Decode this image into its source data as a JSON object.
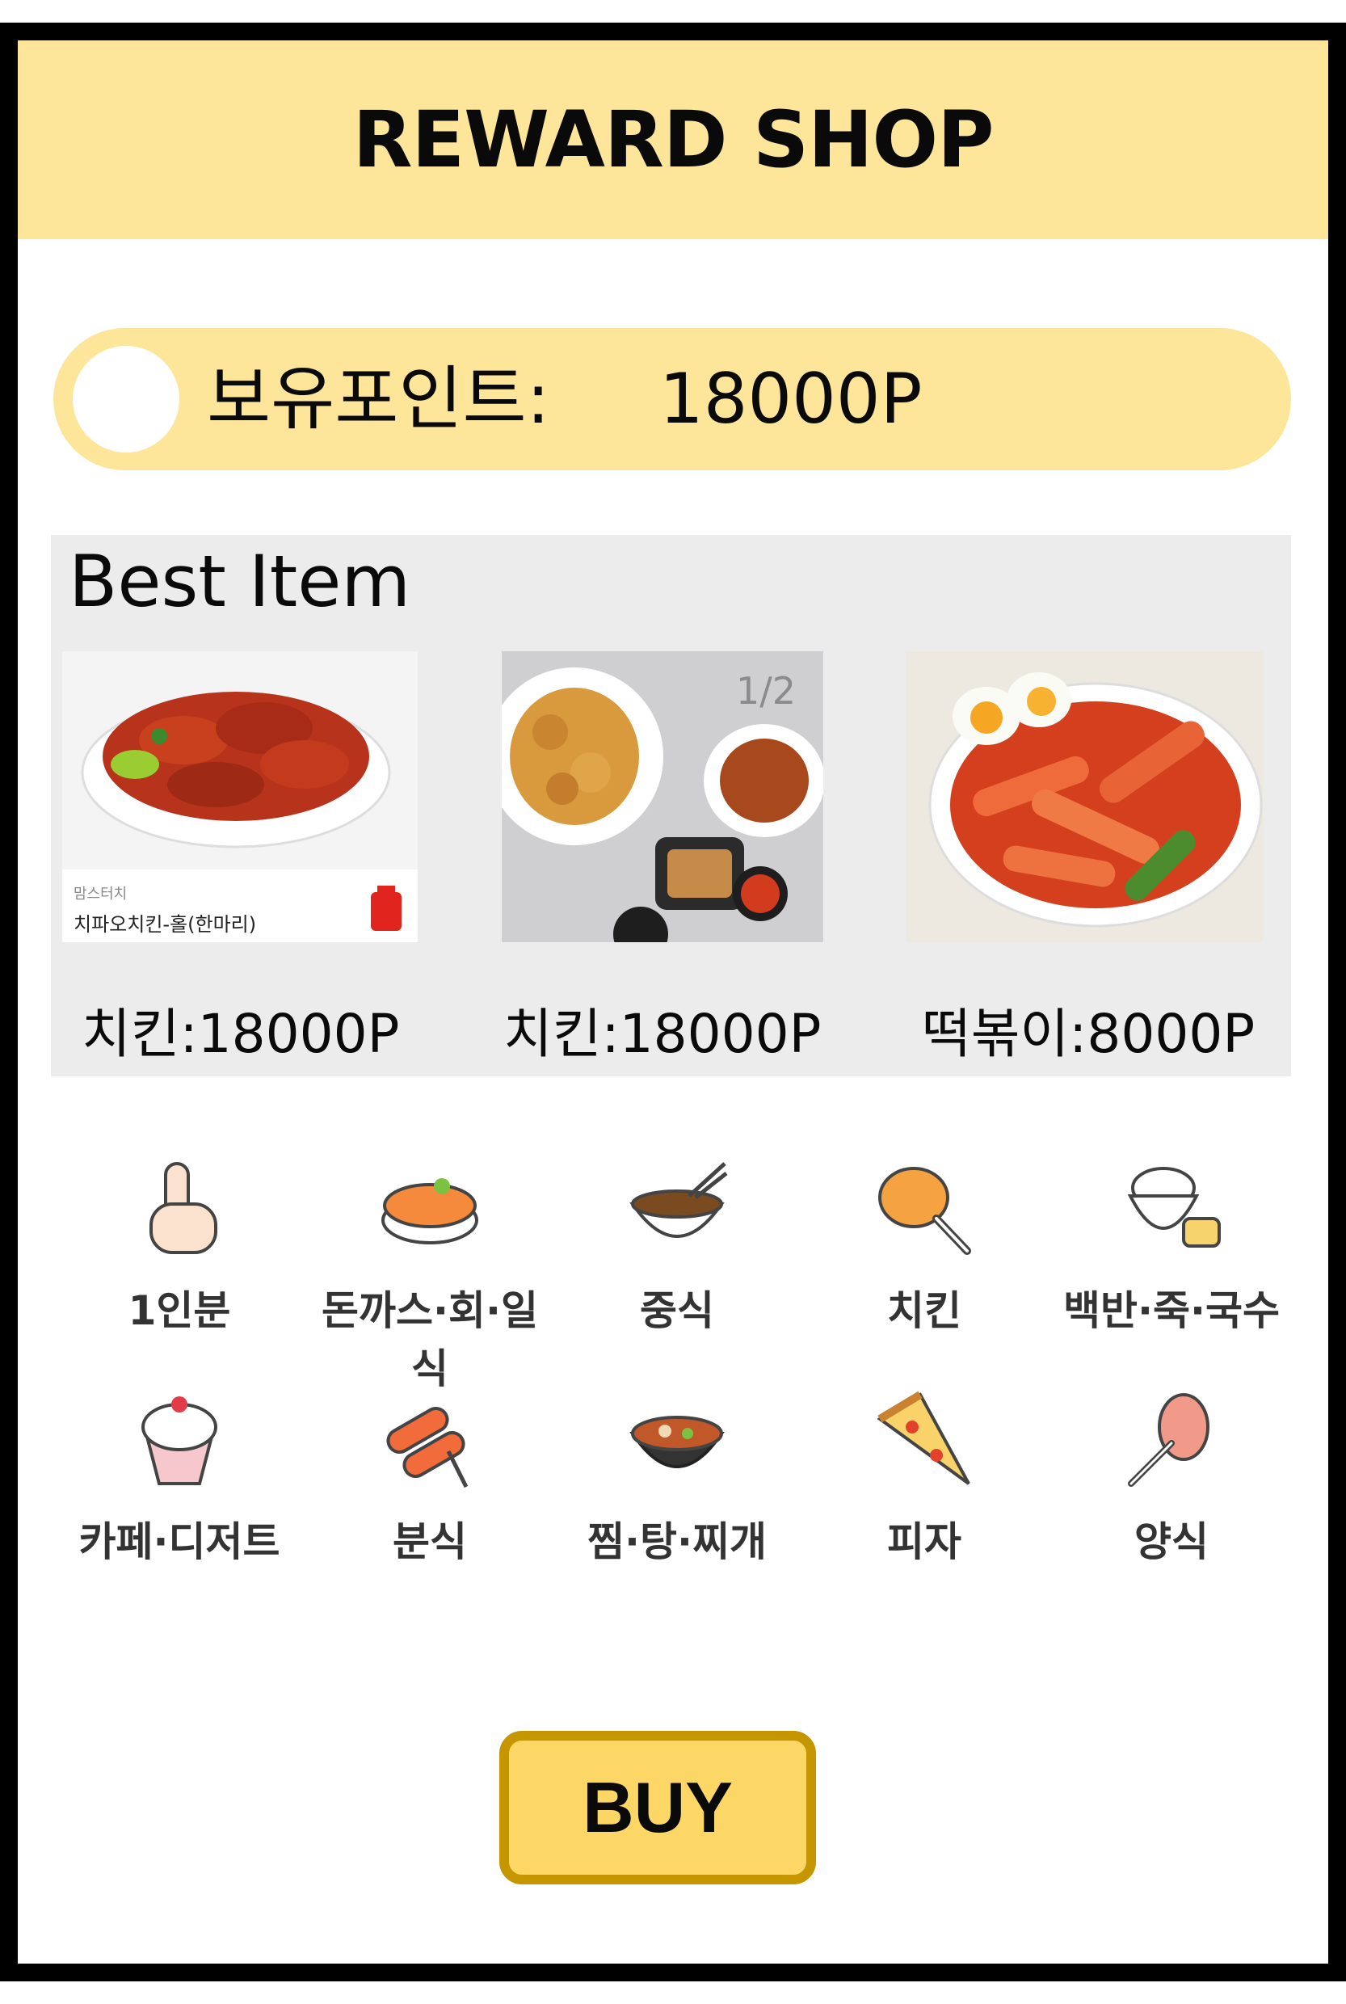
{
  "header": {
    "title": "REWARD SHOP"
  },
  "points": {
    "label": "보유포인트:",
    "value": "18000P",
    "coin_icon": "coin-icon"
  },
  "best": {
    "title": "Best Item",
    "items": [
      {
        "price": "치킨:18000P",
        "image": "chicken-plate-image",
        "brand": "맘스터치",
        "name": "치파오치킨-홀(한마리)"
      },
      {
        "price": "치킨:18000P",
        "image": "fried-chicken-set-image",
        "overlay": "1/2"
      },
      {
        "price": "떡볶이:8000P",
        "image": "tteokbokki-image"
      }
    ]
  },
  "categories": [
    {
      "label": "1인분",
      "icon": "hand-one-icon"
    },
    {
      "label": "돈까스·회·일식",
      "icon": "sushi-icon"
    },
    {
      "label": "중식",
      "icon": "noodle-bowl-icon"
    },
    {
      "label": "치킨",
      "icon": "chicken-leg-icon"
    },
    {
      "label": "백반·죽·국수",
      "icon": "rice-bowl-icon"
    },
    {
      "label": "카페·디저트",
      "icon": "cupcake-icon"
    },
    {
      "label": "분식",
      "icon": "tteokbokki-icon"
    },
    {
      "label": "찜·탕·찌개",
      "icon": "stew-pot-icon"
    },
    {
      "label": "피자",
      "icon": "pizza-slice-icon"
    },
    {
      "label": "양식",
      "icon": "pasta-fork-icon"
    }
  ],
  "buy": {
    "label": "BUY"
  },
  "colors": {
    "accent": "#fde599",
    "button": "#fcd766",
    "button_border": "#c59600",
    "panel": "#ececec"
  }
}
